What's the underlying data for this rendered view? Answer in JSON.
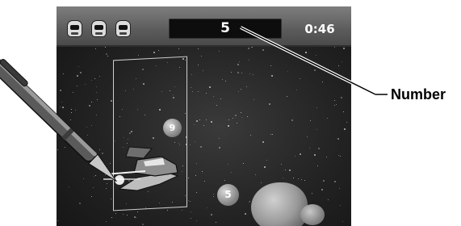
{
  "hud": {
    "lives": [
      "helmet-icon",
      "helmet-icon",
      "helmet-icon"
    ],
    "number": "5",
    "timer": "0:46"
  },
  "bubbles": {
    "upper": "9",
    "lower": "5"
  },
  "callout": {
    "label": "Number"
  },
  "icons": {
    "lives": "helmet-icon",
    "pen": "stylus-icon",
    "ship": "spaceship-icon"
  }
}
